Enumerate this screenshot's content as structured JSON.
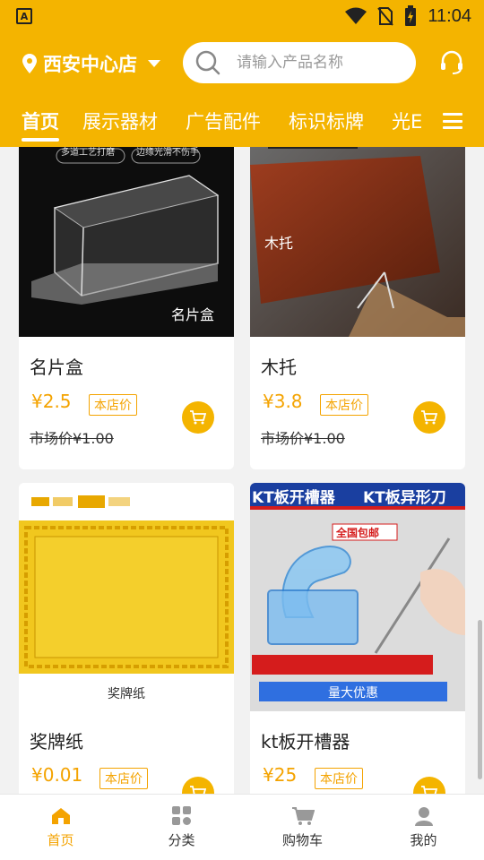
{
  "status_bar": {
    "time": "11:04",
    "left_icon_label": "A"
  },
  "header": {
    "location": "西安中心店",
    "search_placeholder": "请输入产品名称",
    "tabs": [
      "首页",
      "展示器材",
      "广告配件",
      "标识标牌",
      "光E"
    ]
  },
  "products": [
    {
      "name": "名片盒",
      "price": "¥2.5",
      "badge": "本店价",
      "market_price": "市场价¥1.00",
      "image_texts": [
        "多道工艺打磨",
        "边缘光滑不伤手",
        "名片盒"
      ]
    },
    {
      "name": "木托",
      "price": "¥3.8",
      "badge": "本店价",
      "market_price": "市场价¥1.00",
      "image_texts": [
        "木托"
      ]
    },
    {
      "name": "奖牌纸",
      "price": "¥0.01",
      "badge": "本店价",
      "image_texts": [
        "奖牌纸"
      ]
    },
    {
      "name": "kt板开槽器",
      "price": "¥25",
      "badge": "本店价",
      "image_texts": [
        "KT板开槽器",
        "KT板异形刀",
        "全国包邮",
        "量大优惠"
      ]
    }
  ],
  "bottom_nav": [
    "首页",
    "分类",
    "购物车",
    "我的"
  ],
  "colors": {
    "accent": "#f4b400",
    "price": "#f4a300"
  }
}
